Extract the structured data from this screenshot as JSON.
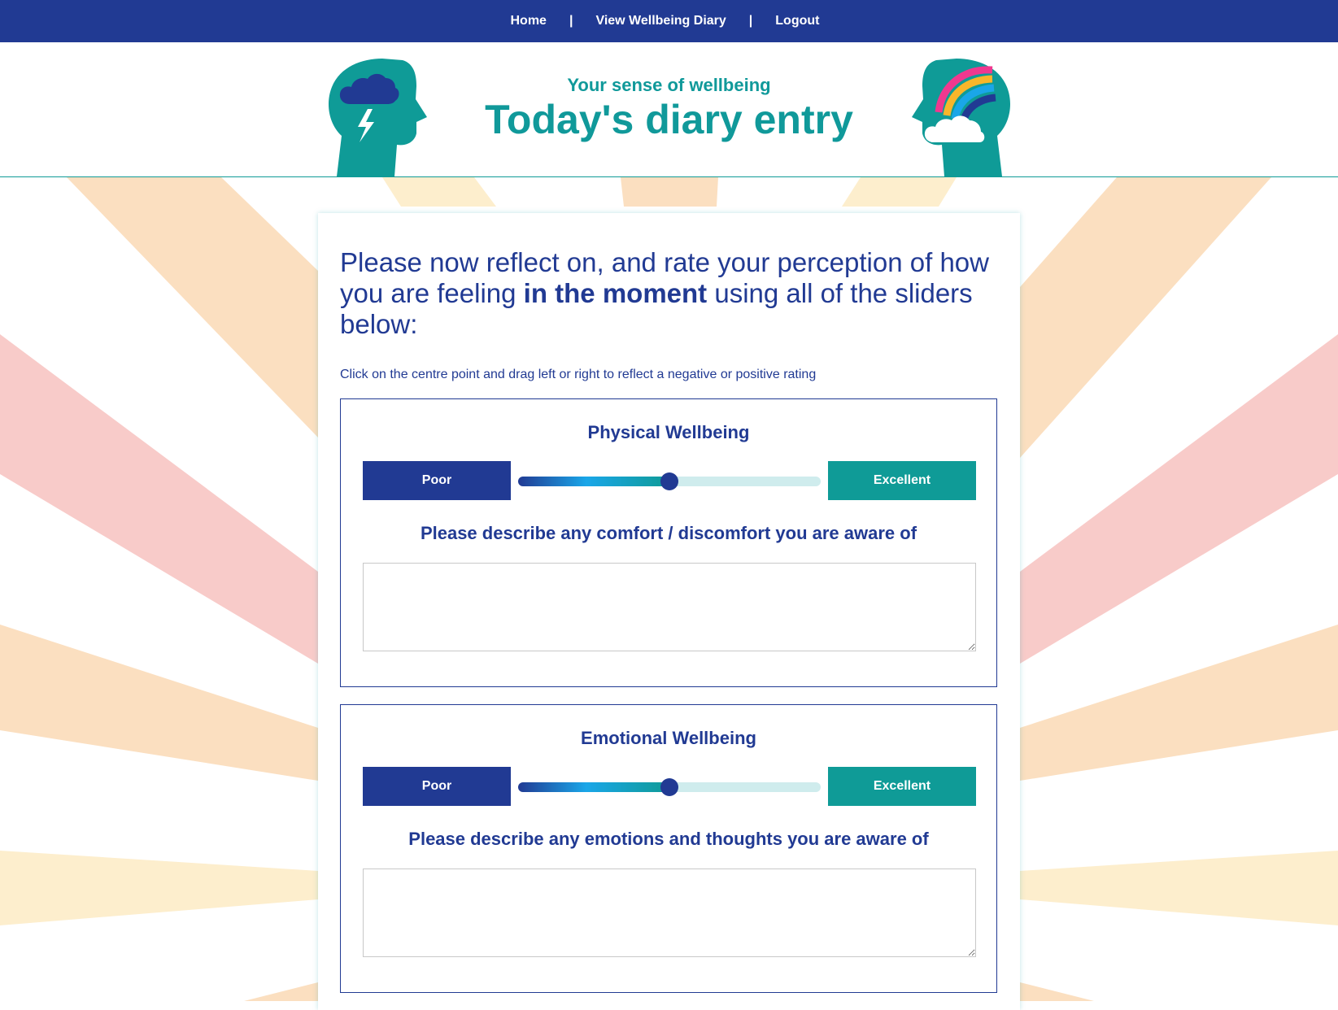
{
  "nav": {
    "home": "Home",
    "separator": "|",
    "diary": "View Wellbeing Diary",
    "logout": "Logout"
  },
  "header": {
    "subtitle": "Your sense of wellbeing",
    "title": "Today's diary entry"
  },
  "intro": {
    "before": "Please now reflect on, and rate your perception of how you are feeling ",
    "emphasis": "in the moment",
    "after": " using all of the sliders below:"
  },
  "hint": "Click on the centre point and drag left or right to reflect a negative or positive rating",
  "sections": [
    {
      "title": "Physical Wellbeing",
      "poor_label": "Poor",
      "excellent_label": "Excellent",
      "slider_value": 0.5,
      "question": "Please describe any comfort / discomfort you are aware of",
      "text_value": ""
    },
    {
      "title": "Emotional Wellbeing",
      "poor_label": "Poor",
      "excellent_label": "Excellent",
      "slider_value": 0.5,
      "question": "Please describe any emotions and thoughts you are aware of",
      "text_value": ""
    }
  ],
  "colors": {
    "navy": "#213a93",
    "teal": "#0f9b97",
    "ray_orange": "#fbdfc0",
    "ray_pink": "#f8cbc9",
    "ray_yellow": "#fdeecd"
  },
  "icons": {
    "left_head": "head-storm-icon",
    "right_head": "head-rainbow-icon"
  }
}
